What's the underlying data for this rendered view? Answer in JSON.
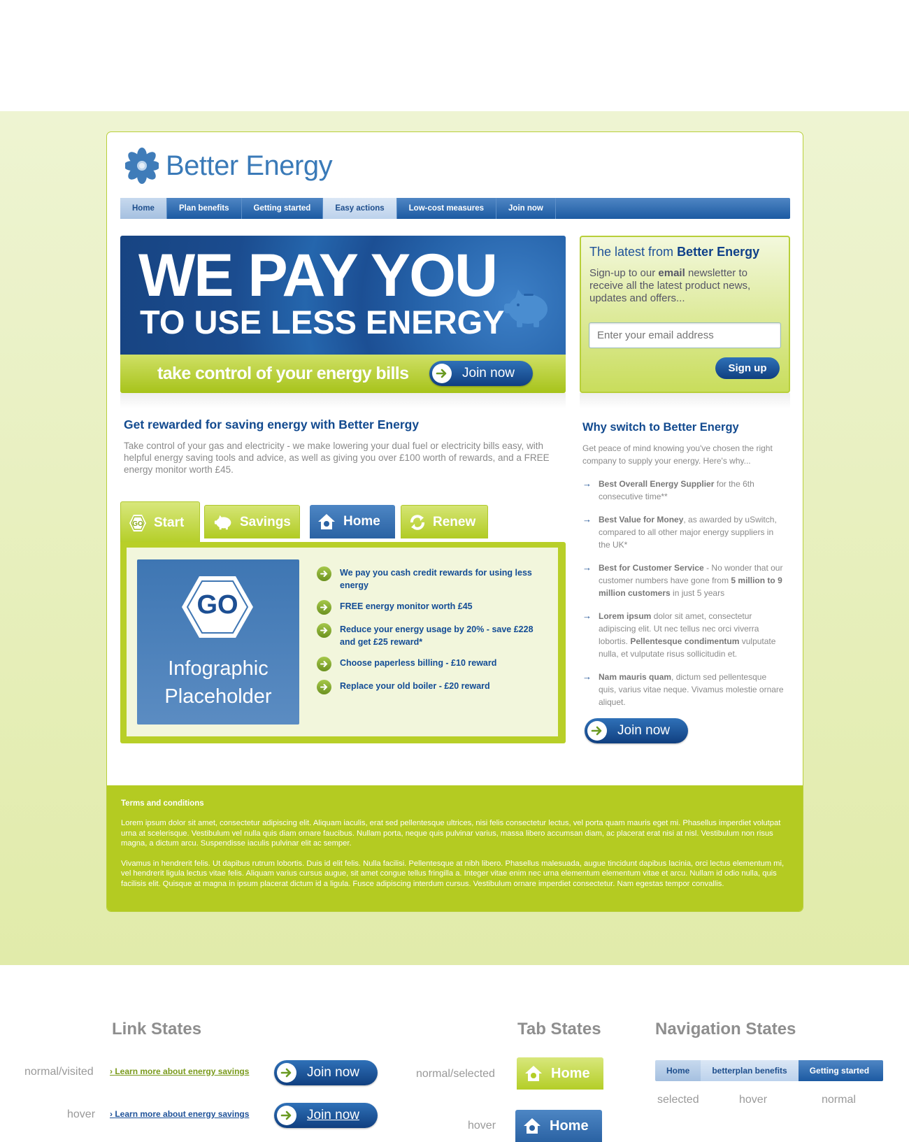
{
  "brand": {
    "name": "Better Energy"
  },
  "nav": {
    "items": [
      "Home",
      "Plan benefits",
      "Getting started",
      "Easy actions",
      "Low-cost measures",
      "Join now"
    ]
  },
  "hero": {
    "headline": "WE PAY YOU",
    "subheadline": "TO USE LESS ENERGY",
    "tagline": "take control of your energy bills",
    "cta": "Join now"
  },
  "newsletter": {
    "title_prefix": "The latest from",
    "title_brand": "Better Energy",
    "text_pre": "Sign-up to our",
    "text_bold": "email",
    "text_post": "newsletter to receive all the latest product news, updates and offers...",
    "placeholder": "Enter your email address",
    "button": "Sign up"
  },
  "main": {
    "heading": "Get rewarded for saving energy with Better Energy",
    "intro": "Take control of your gas and electricity - we make lowering your dual fuel or electricity bills easy, with helpful energy saving tools and advice, as well as giving you over £100 worth of rewards, and a FREE energy monitor worth £45."
  },
  "tabs": [
    {
      "label": "Start",
      "icon": "go-icon"
    },
    {
      "label": "Savings",
      "icon": "piggy-bank-icon"
    },
    {
      "label": "Home",
      "icon": "home-icon"
    },
    {
      "label": "Renew",
      "icon": "renew-icon"
    }
  ],
  "infographic": {
    "go": "GO",
    "line1": "Infographic",
    "line2": "Placeholder"
  },
  "benefits": [
    "We pay you cash credit rewards for using less energy",
    "FREE energy monitor worth £45",
    "Reduce your energy usage by 20% - save £228 and get £25 reward*",
    "Choose paperless billing - £10 reward",
    "Replace your old boiler - £20 reward"
  ],
  "why": {
    "heading": "Why switch to Better Energy",
    "intro": "Get peace of mind knowing you've chosen the right company to supply your energy. Here's why...",
    "items": [
      {
        "bold": "Best Overall Energy Supplier",
        "text": " for the 6th consecutive time**"
      },
      {
        "bold": "Best Value for Money",
        "text": ", as awarded by uSwitch, compared to all other major energy suppliers in the UK*"
      },
      {
        "bold": "Best for Customer Service",
        "text": " - No wonder that our customer numbers have gone from ",
        "bold2": "5 million to 9 million customers",
        "text2": " in just 5 years"
      },
      {
        "bold": "Lorem ipsum",
        "text": " dolor sit amet, consectetur adipiscing elit. Ut nec tellus nec orci viverra lobortis. ",
        "bold2": "Pellentesque condimentum",
        "text2": " vulputate nulla, et vulputate risus sollicitudin et."
      },
      {
        "bold": "Nam mauris quam",
        "text": ", dictum sed pellentesque quis, varius vitae neque. Vivamus molestie ornare aliquet."
      }
    ],
    "cta": "Join now"
  },
  "footer": {
    "heading": "Terms and conditions",
    "p1": "Lorem ipsum dolor sit amet, consectetur adipiscing elit. Aliquam iaculis, erat sed pellentesque ultrices, nisi felis consectetur lectus, vel porta quam mauris eget mi. Phasellus imperdiet volutpat urna at scelerisque. Vestibulum vel nulla quis diam ornare faucibus. Nullam porta, neque quis pulvinar varius, massa libero accumsan diam, ac placerat erat nisi at nisl. Vestibulum non risus magna, a dictum arcu. Suspendisse iaculis pulvinar elit ac semper.",
    "p2": "Vivamus in hendrerit felis. Ut dapibus rutrum lobortis. Duis id elit felis. Nulla facilisi. Pellentesque at nibh libero. Phasellus malesuada, augue tincidunt dapibus lacinia, orci lectus elementum mi, vel hendrerit ligula lectus vitae felis. Aliquam varius cursus augue, sit amet congue tellus fringilla a. Integer vitae enim nec urna elementum elementum vitae et arcu. Nullam id odio nulla, quis facilisis elit. Quisque at magna in ipsum placerat dictum id a ligula. Fusce adipiscing interdum cursus. Vestibulum ornare imperdiet consectetur. Nam egestas tempor convallis."
  },
  "legend": {
    "link_states": "Link States",
    "tab_states": "Tab States",
    "nav_states": "Navigation States",
    "normal_visited": "normal/visited",
    "hover": "hover",
    "normal_selected": "normal/selected",
    "link_text": "Learn more about energy savings",
    "link_marker": "›",
    "join": "Join now",
    "tab_home": "Home",
    "nav_items": [
      "Home",
      "betterplan benefits",
      "Getting started"
    ],
    "nav_labels": [
      "selected",
      "hover",
      "normal"
    ]
  },
  "colors": {
    "brand_blue": "#1e5198",
    "lime": "#b4cb22",
    "link_green": "#7a9a1c",
    "link_blue": "#1e5198"
  }
}
